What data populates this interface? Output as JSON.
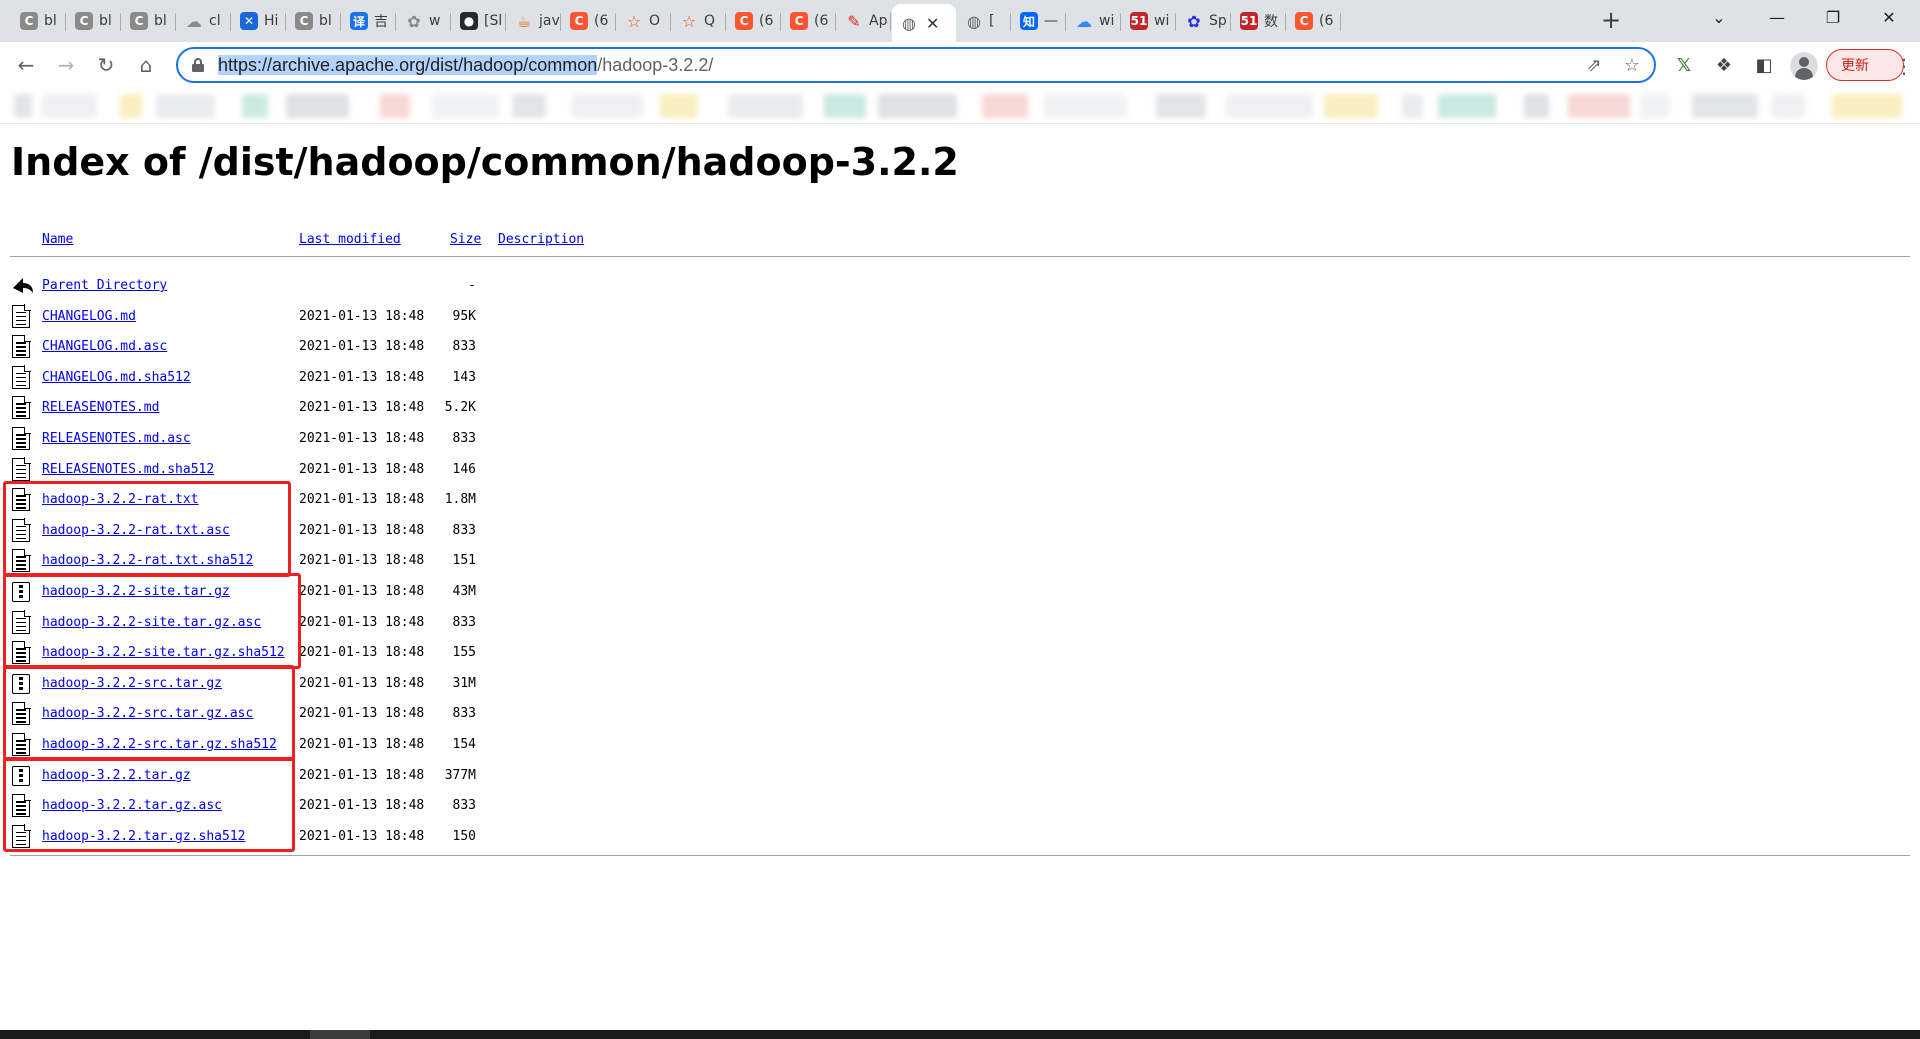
{
  "browser": {
    "tabs": [
      {
        "id": "t1",
        "title": "bl",
        "icon": "csdn-gray-icon",
        "fav": "C",
        "color": "#8a8a8a"
      },
      {
        "id": "t2",
        "title": "bl",
        "icon": "csdn-gray-icon",
        "fav": "C",
        "color": "#8a8a8a"
      },
      {
        "id": "t3",
        "title": "bl",
        "icon": "csdn-gray-icon",
        "fav": "C",
        "color": "#8a8a8a"
      },
      {
        "id": "t4",
        "title": "cl",
        "icon": "cloud-icon",
        "fav": "☁",
        "color": "#8a8a8a"
      },
      {
        "id": "t5",
        "title": "Hi",
        "icon": "confluence-icon",
        "fav": "✕",
        "color": "#1868db"
      },
      {
        "id": "t6",
        "title": "bl",
        "icon": "csdn-gray-icon",
        "fav": "C",
        "color": "#8a8a8a"
      },
      {
        "id": "t7",
        "title": "吉",
        "icon": "translate-icon",
        "fav": "译",
        "color": "#1a73e8"
      },
      {
        "id": "t8",
        "title": "w",
        "icon": "baidu-paw-icon",
        "fav": "✿",
        "color": "#888888"
      },
      {
        "id": "t9",
        "title": "[Sl",
        "icon": "github-icon",
        "fav": "●",
        "color": "#24292f"
      },
      {
        "id": "t10",
        "title": "jav",
        "icon": "java-icon",
        "fav": "☕",
        "color": "#e76f00"
      },
      {
        "id": "t11",
        "title": "(6",
        "icon": "csdn-icon",
        "fav": "C",
        "color": "#fc5531"
      },
      {
        "id": "t12",
        "title": "O",
        "icon": "star-icon",
        "fav": "☆",
        "color": "#e8590c"
      },
      {
        "id": "t13",
        "title": "Q",
        "icon": "star-icon",
        "fav": "☆",
        "color": "#e8590c"
      },
      {
        "id": "t14",
        "title": "(6",
        "icon": "csdn-icon",
        "fav": "C",
        "color": "#fc5531"
      },
      {
        "id": "t15",
        "title": "(6",
        "icon": "csdn-icon",
        "fav": "C",
        "color": "#fc5531"
      },
      {
        "id": "t16",
        "title": "Ap",
        "icon": "pen-icon",
        "fav": "✎",
        "color": "#d93025"
      },
      {
        "id": "t17",
        "title": "",
        "icon": "globe-icon",
        "fav": "◍",
        "color": "#5f6368",
        "active": true
      },
      {
        "id": "t18",
        "title": "[",
        "icon": "globe-icon",
        "fav": "◍",
        "color": "#5f6368"
      },
      {
        "id": "t19",
        "title": "—",
        "icon": "zhihu-icon",
        "fav": "知",
        "color": "#0066ff"
      },
      {
        "id": "t20",
        "title": "wi",
        "icon": "cloud-blue-icon",
        "fav": "☁",
        "color": "#2f88ff"
      },
      {
        "id": "t21",
        "title": "wi",
        "icon": "51cto-icon",
        "fav": "51",
        "color": "#c0262b"
      },
      {
        "id": "t22",
        "title": "Sp",
        "icon": "baidu-icon",
        "fav": "✿",
        "color": "#2932e1"
      },
      {
        "id": "t23",
        "title": "数",
        "icon": "51cto-icon",
        "fav": "51",
        "color": "#c0262b"
      },
      {
        "id": "t24",
        "title": "(6",
        "icon": "csdn-icon",
        "fav": "C",
        "color": "#fc5531"
      }
    ],
    "new_tab": "+",
    "controls": {
      "dropdown": "⌄",
      "minimize": "—",
      "restore": "❐",
      "close": "✕"
    },
    "url_selected": "https://archive.apache.org/dist/hadoop/common",
    "url_rest": "/hadoop-3.2.2/",
    "update_label": "更新"
  },
  "page": {
    "title": "Index of /dist/hadoop/common/hadoop-3.2.2",
    "headers": {
      "name": "Name",
      "modified": "Last modified",
      "size": "Size",
      "description": "Description"
    },
    "rows": [
      {
        "name": "Parent Directory",
        "date": "",
        "size": "-",
        "icon": "back-icon"
      },
      {
        "name": "CHANGELOG.md",
        "date": "2021-01-13 18:48",
        "size": "95K",
        "icon": "text-file-icon"
      },
      {
        "name": "CHANGELOG.md.asc",
        "date": "2021-01-13 18:48",
        "size": "833",
        "icon": "text-file-icon"
      },
      {
        "name": "CHANGELOG.md.sha512",
        "date": "2021-01-13 18:48",
        "size": "143",
        "icon": "text-file-icon"
      },
      {
        "name": "RELEASENOTES.md",
        "date": "2021-01-13 18:48",
        "size": "5.2K",
        "icon": "text-file-icon"
      },
      {
        "name": "RELEASENOTES.md.asc",
        "date": "2021-01-13 18:48",
        "size": "833",
        "icon": "text-file-icon"
      },
      {
        "name": "RELEASENOTES.md.sha512",
        "date": "2021-01-13 18:48",
        "size": "146",
        "icon": "text-file-icon"
      },
      {
        "name": "hadoop-3.2.2-rat.txt",
        "date": "2021-01-13 18:48",
        "size": "1.8M",
        "icon": "text-file-icon"
      },
      {
        "name": "hadoop-3.2.2-rat.txt.asc",
        "date": "2021-01-13 18:48",
        "size": "833",
        "icon": "text-file-icon"
      },
      {
        "name": "hadoop-3.2.2-rat.txt.sha512",
        "date": "2021-01-13 18:48",
        "size": "151",
        "icon": "text-file-icon"
      },
      {
        "name": "hadoop-3.2.2-site.tar.gz",
        "date": "2021-01-13 18:48",
        "size": "43M",
        "icon": "archive-icon"
      },
      {
        "name": "hadoop-3.2.2-site.tar.gz.asc",
        "date": "2021-01-13 18:48",
        "size": "833",
        "icon": "text-file-icon"
      },
      {
        "name": "hadoop-3.2.2-site.tar.gz.sha512",
        "date": "2021-01-13 18:48",
        "size": "155",
        "icon": "text-file-icon"
      },
      {
        "name": "hadoop-3.2.2-src.tar.gz",
        "date": "2021-01-13 18:48",
        "size": "31M",
        "icon": "archive-icon"
      },
      {
        "name": "hadoop-3.2.2-src.tar.gz.asc",
        "date": "2021-01-13 18:48",
        "size": "833",
        "icon": "text-file-icon"
      },
      {
        "name": "hadoop-3.2.2-src.tar.gz.sha512",
        "date": "2021-01-13 18:48",
        "size": "154",
        "icon": "text-file-icon"
      },
      {
        "name": "hadoop-3.2.2.tar.gz",
        "date": "2021-01-13 18:48",
        "size": "377M",
        "icon": "archive-icon"
      },
      {
        "name": "hadoop-3.2.2.tar.gz.asc",
        "date": "2021-01-13 18:48",
        "size": "833",
        "icon": "text-file-icon"
      },
      {
        "name": "hadoop-3.2.2.tar.gz.sha512",
        "date": "2021-01-13 18:48",
        "size": "150",
        "icon": "text-file-icon"
      }
    ],
    "highlight_color": "#f02020"
  }
}
